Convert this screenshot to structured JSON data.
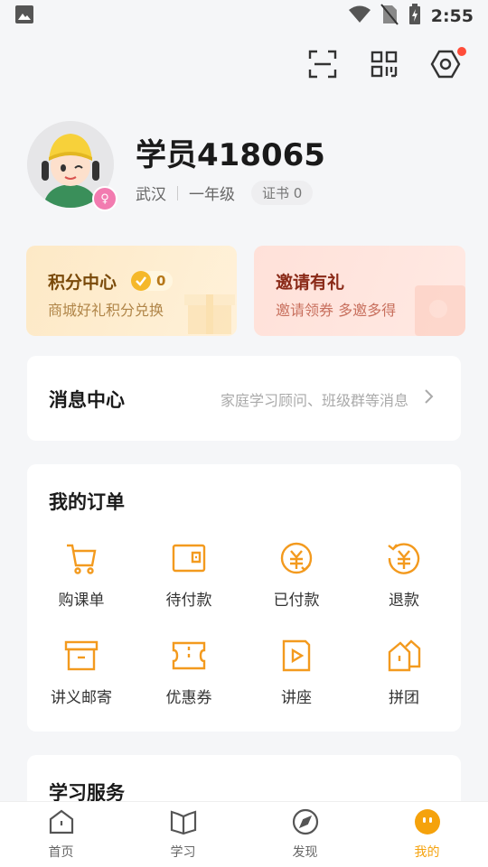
{
  "status": {
    "time": "2:55"
  },
  "profile": {
    "username": "学员418065",
    "city": "武汉",
    "grade": "一年级",
    "cert_label": "证书",
    "cert_count": "0"
  },
  "points": {
    "title": "积分中心",
    "count": "0",
    "subtitle": "商城好礼积分兑换"
  },
  "invite": {
    "title": "邀请有礼",
    "subtitle": "邀请领券 多邀多得"
  },
  "messages": {
    "title": "消息中心",
    "hint": "家庭学习顾问、班级群等消息"
  },
  "orders": {
    "title": "我的订单",
    "items": [
      {
        "label": "购课单",
        "icon": "cart-icon"
      },
      {
        "label": "待付款",
        "icon": "wallet-icon"
      },
      {
        "label": "已付款",
        "icon": "paid-icon"
      },
      {
        "label": "退款",
        "icon": "refund-icon"
      },
      {
        "label": "讲义邮寄",
        "icon": "box-icon"
      },
      {
        "label": "优惠券",
        "icon": "coupon-icon"
      },
      {
        "label": "讲座",
        "icon": "lecture-icon"
      },
      {
        "label": "拼团",
        "icon": "group-icon"
      }
    ]
  },
  "services": {
    "title": "学习服务"
  },
  "tabs": [
    {
      "label": "首页",
      "icon": "home-icon"
    },
    {
      "label": "学习",
      "icon": "book-icon"
    },
    {
      "label": "发现",
      "icon": "compass-icon"
    },
    {
      "label": "我的",
      "icon": "profile-face-icon"
    }
  ],
  "colors": {
    "accent": "#f5a20c",
    "icon_orange": "#f39a1e",
    "notification": "#ff4d3a"
  }
}
